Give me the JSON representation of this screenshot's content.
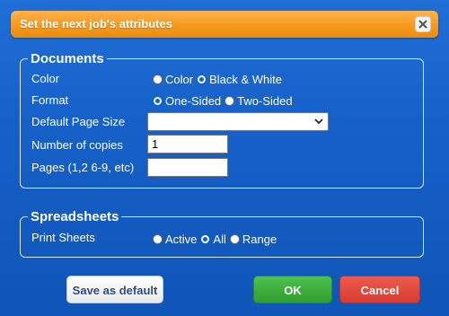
{
  "dialog": {
    "title": "Set the next job's attributes"
  },
  "documents": {
    "legend": "Documents",
    "color": {
      "label": "Color",
      "options": [
        {
          "label": "Color",
          "checked": false
        },
        {
          "label": "Black & White",
          "checked": true
        }
      ]
    },
    "format": {
      "label": "Format",
      "options": [
        {
          "label": "One-Sided",
          "checked": true
        },
        {
          "label": "Two-Sided",
          "checked": false
        }
      ]
    },
    "page_size": {
      "label": "Default Page Size",
      "value": ""
    },
    "copies": {
      "label": "Number of copies",
      "value": "1"
    },
    "pages": {
      "label": "Pages (1,2 6-9, etc)",
      "value": ""
    }
  },
  "spreadsheets": {
    "legend": "Spreadsheets",
    "print_sheets": {
      "label": "Print Sheets",
      "options": [
        {
          "label": "Active",
          "checked": false
        },
        {
          "label": "All",
          "checked": true
        },
        {
          "label": "Range",
          "checked": false
        }
      ]
    }
  },
  "buttons": {
    "save_default": "Save as default",
    "ok": "OK",
    "cancel": "Cancel"
  },
  "colors": {
    "background": "#1660c8",
    "title_bar": "#f59a1f",
    "ok": "#2f9f2f",
    "cancel": "#d63b30"
  }
}
